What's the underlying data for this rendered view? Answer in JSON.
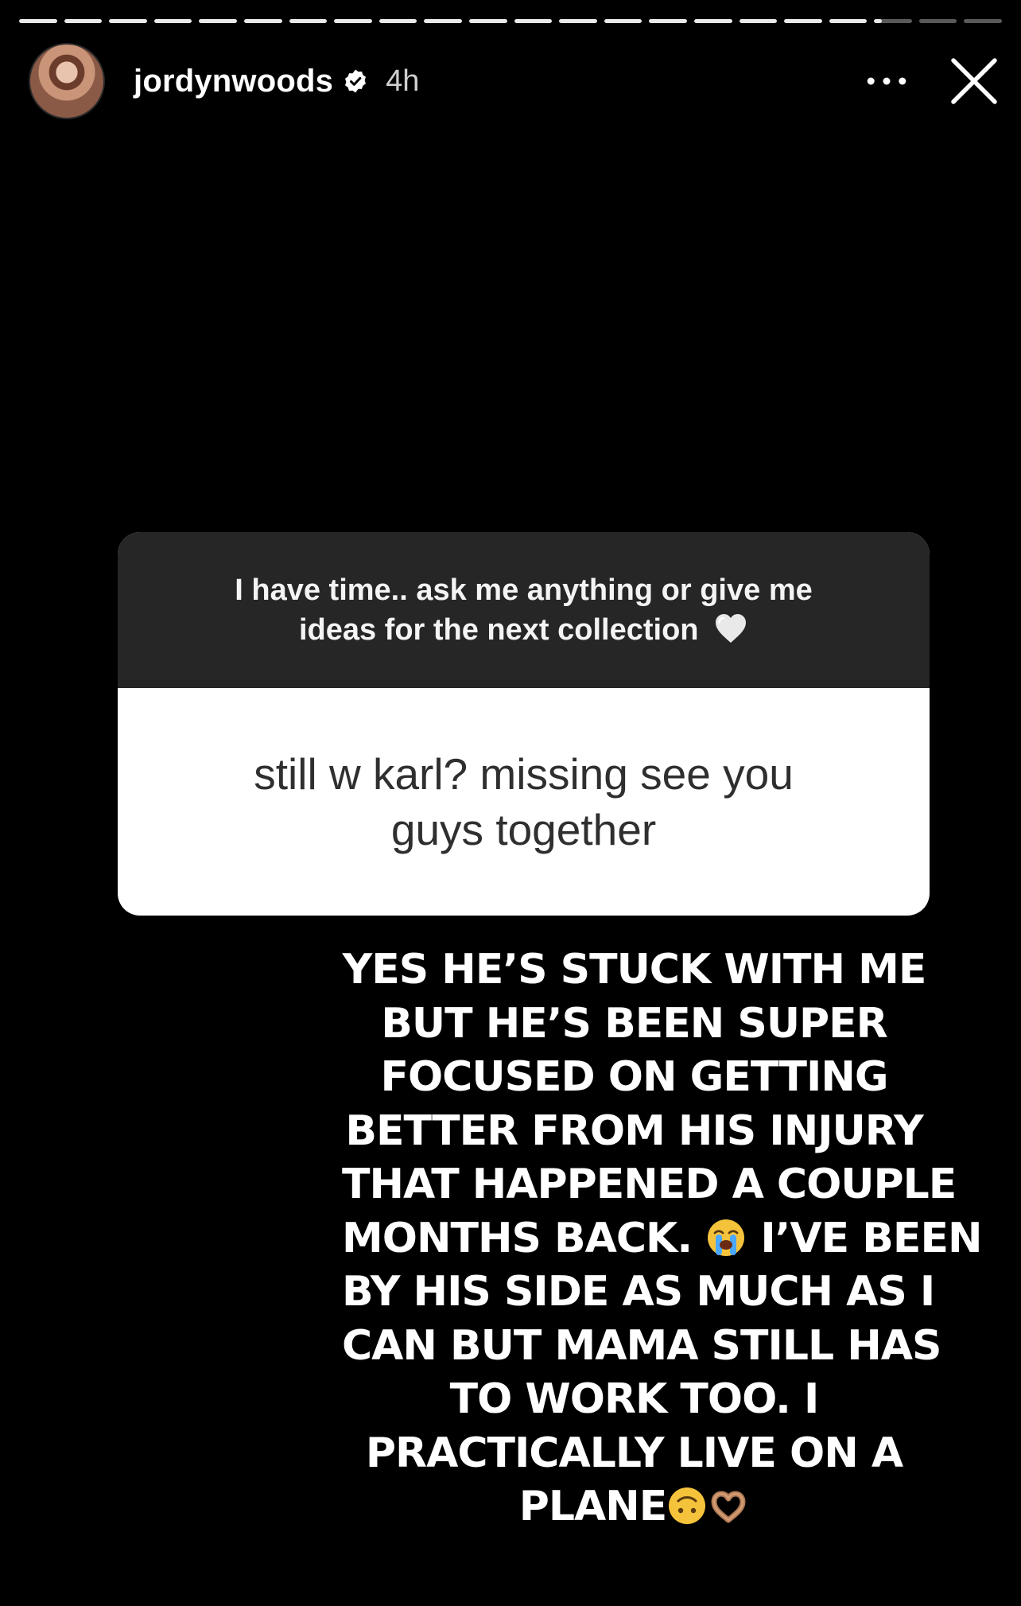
{
  "story": {
    "progress": {
      "segments_total": 22,
      "segments_complete": 19,
      "current_segment_fill": 0.2
    },
    "header": {
      "username": "jordynwoods",
      "verified": true,
      "time_ago": "4h",
      "icons": {
        "avatar": "profile-photo",
        "verified": "verified-badge-icon",
        "more": "more-horizontal-icon",
        "close": "close-icon"
      }
    },
    "question_sticker": {
      "prompt_line1": "I have time.. ask me anything or give me",
      "prompt_line2": "ideas for the next collection",
      "prompt_emoji": "white-heart-icon",
      "answer_line1": "still w karl? missing see you",
      "answer_line2": "guys together"
    },
    "reply": {
      "lines": [
        "YES HE’S STUCK WITH ME",
        "BUT HE’S BEEN SUPER",
        "FOCUSED ON GETTING",
        "BETTER FROM HIS INJURY",
        "THAT HAPPENED A COUPLE",
        "MONTHS BACK.",
        "I’VE BEEN",
        "BY HIS SIDE AS MUCH AS I",
        "CAN BUT MAMA STILL HAS",
        "TO WORK TOO. I",
        "PRACTICALLY LIVE ON A",
        "PLANE"
      ],
      "emojis": {
        "crying": "loudly-crying-face-icon",
        "upside_down": "upside-down-face-icon",
        "heart_hands": "heart-hands-icon"
      }
    },
    "colors": {
      "background": "#000000",
      "sticker_top": "#262626",
      "sticker_bottom": "#ffffff",
      "answer_text": "#2f2f2f"
    }
  }
}
